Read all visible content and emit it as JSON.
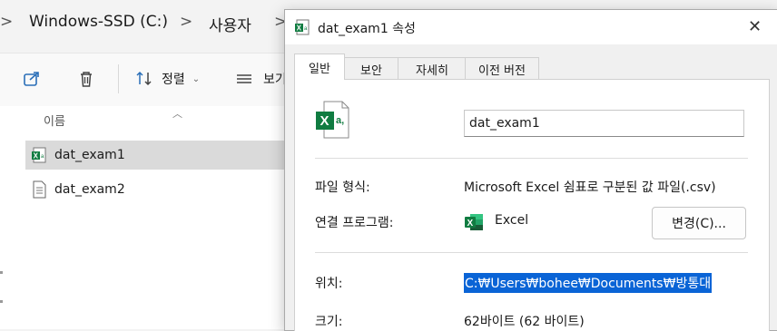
{
  "breadcrumb": {
    "items": [
      "Windows-SSD (C:)",
      "사용자"
    ],
    "separator": ">"
  },
  "toolbar": {
    "sort_label": "정렬",
    "view_label_partial": "보기"
  },
  "file_list": {
    "column_name": "이름",
    "files": [
      {
        "name": "dat_exam1",
        "icon": "excel-csv-icon",
        "selected": true
      },
      {
        "name": "dat_exam2",
        "icon": "text-file-icon",
        "selected": false
      }
    ]
  },
  "dialog": {
    "title": "dat_exam1 속성",
    "tabs": [
      "일반",
      "보안",
      "자세히",
      "이전 버전"
    ],
    "active_tab": "일반",
    "file_name": "dat_exam1",
    "file_type_label": "파일 형식:",
    "file_type_value": "Microsoft Excel 쉼표로 구분된 값 파일(.csv)",
    "opens_with_label": "연결 프로그램:",
    "opens_with_value": "Excel",
    "change_button": "변경(C)...",
    "location_label": "위치:",
    "location_value": "C:₩Users₩bohee₩Documents₩방통대",
    "size_label": "크기:",
    "size_value": "62바이트 (62 바이트)"
  },
  "colors": {
    "excel_green": "#107c41",
    "selection": "#0a64d6"
  }
}
